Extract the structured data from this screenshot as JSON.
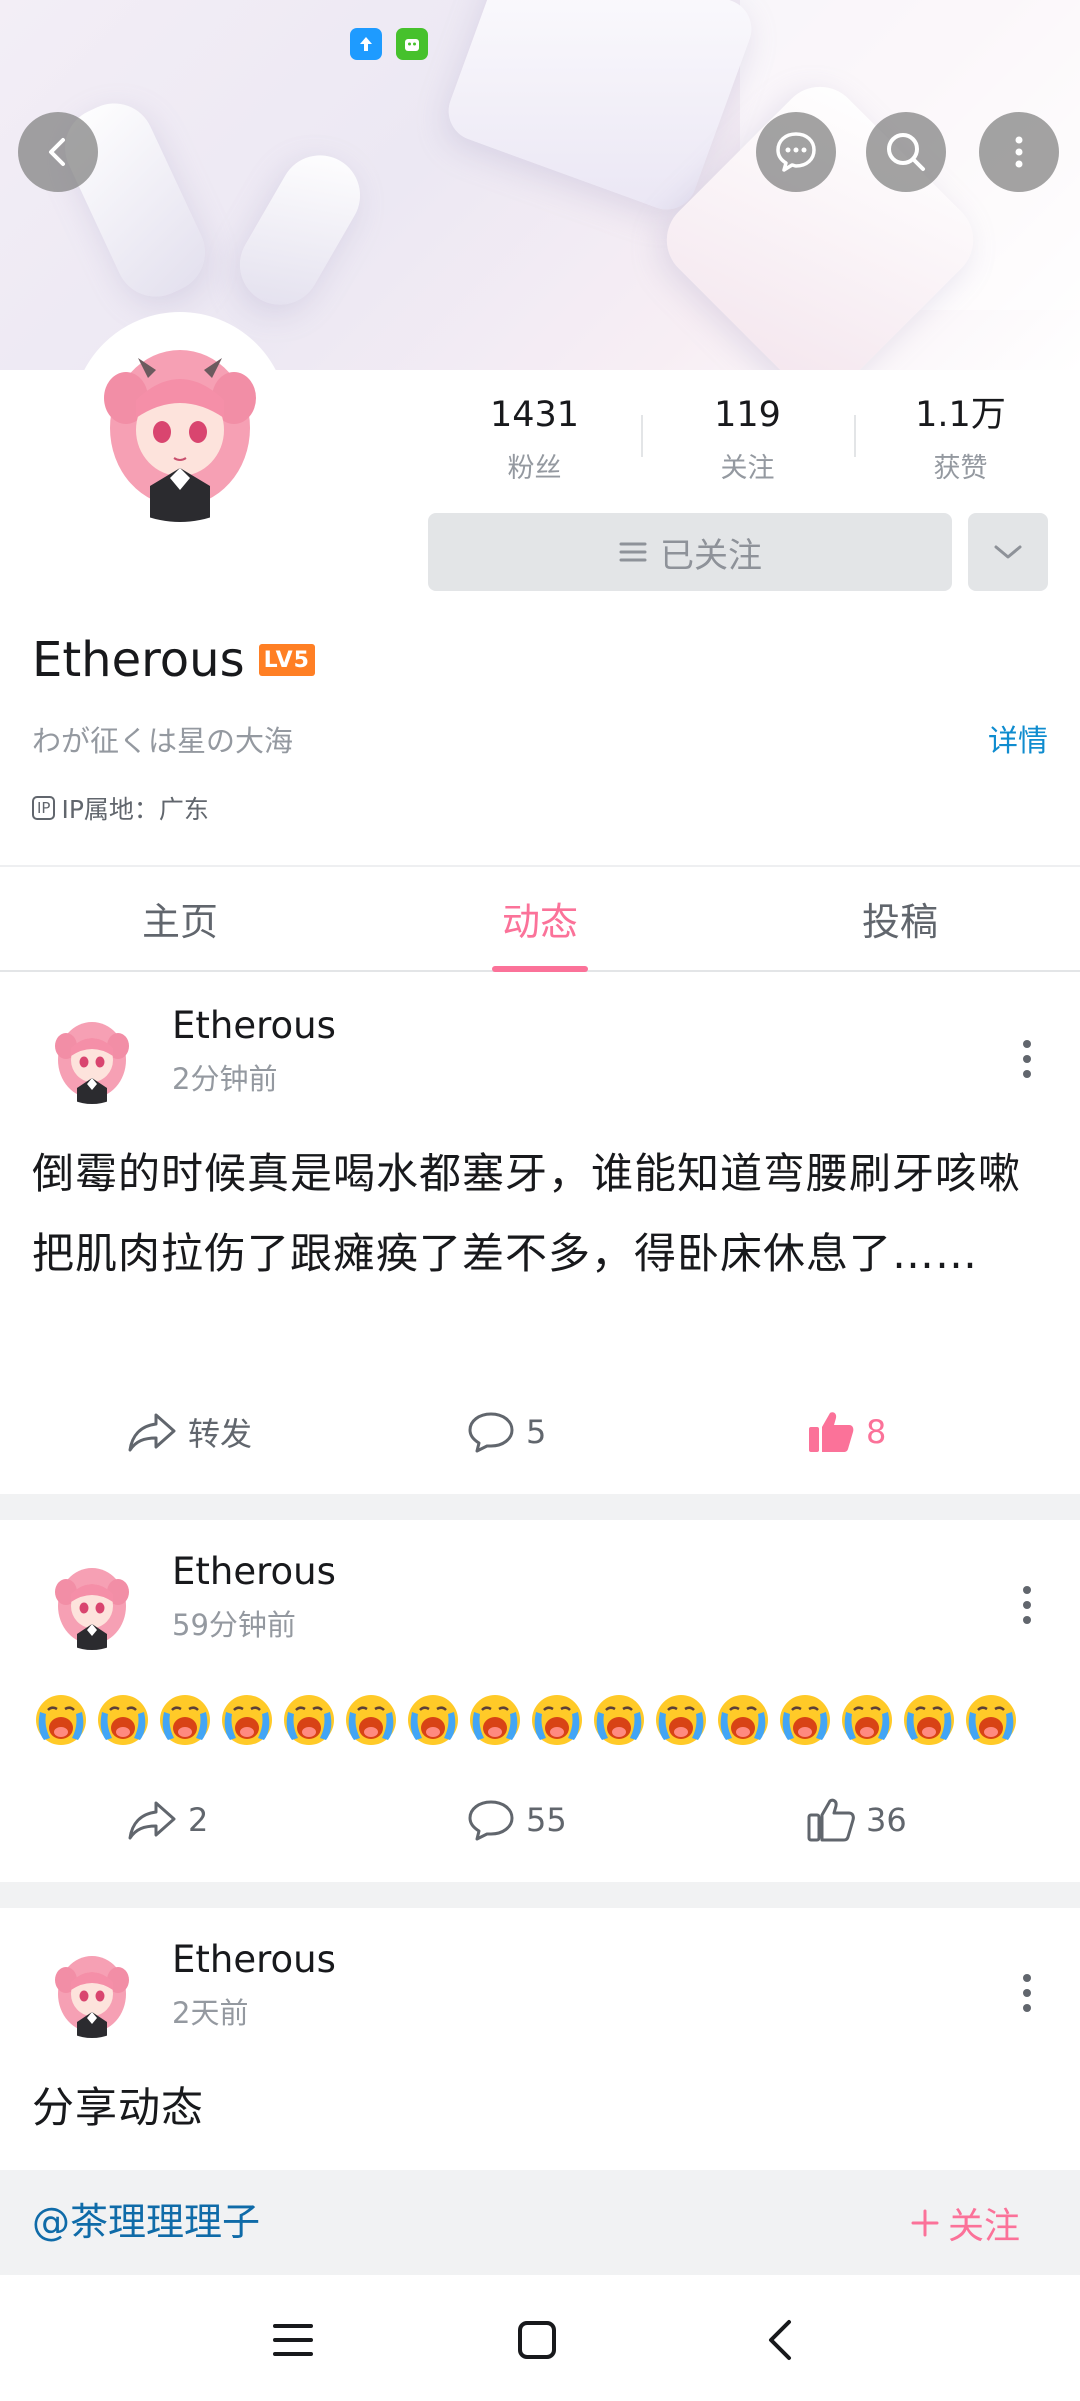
{
  "status_bar": {
    "time_text": "",
    "icons": [
      "upload-arrow-icon",
      "android-robot-icon"
    ]
  },
  "header": {
    "back_icon": "back-chevron-icon",
    "message_icon": "chat-bubble-icon",
    "search_icon": "search-icon",
    "more_icon": "more-vertical-icon"
  },
  "profile": {
    "stats": [
      {
        "value": "1431",
        "label": "粉丝"
      },
      {
        "value": "119",
        "label": "关注"
      },
      {
        "value": "1.1万",
        "label": "获赞"
      }
    ],
    "followed_label": "已关注",
    "username": "Etherous",
    "level_badge": "LV5",
    "signature": "わが征くは星の大海",
    "details_label": "详情",
    "ip_tag": "IP",
    "ip_location": "IP属地：广东"
  },
  "tabs": [
    {
      "label": "主页",
      "active": false
    },
    {
      "label": "动态",
      "active": true
    },
    {
      "label": "投稿",
      "active": false
    }
  ],
  "posts": [
    {
      "author": "Etherous",
      "time": "2分钟前",
      "text": "倒霉的时候真是喝水都塞牙，谁能知道弯腰刷牙咳嗽把肌肉拉伤了跟瘫痪了差不多，得卧床休息了……",
      "repost_label": "转发",
      "comments": "5",
      "likes": "8",
      "liked": true
    },
    {
      "author": "Etherous",
      "time": "59分钟前",
      "emoji_count": 16,
      "emoji_name": "crying-face-emoji",
      "reposts": "2",
      "comments": "55",
      "likes": "36",
      "liked": false
    },
    {
      "author": "Etherous",
      "time": "2天前",
      "text": "分享动态",
      "shared_user": "@茶理理理子",
      "follow_label": "关注"
    }
  ],
  "colors": {
    "accent_pink": "#fb7299",
    "link_blue": "#0f8ccf",
    "level_orange": "#ff7f24",
    "text_primary": "#18191c",
    "text_secondary": "#9499a0"
  }
}
